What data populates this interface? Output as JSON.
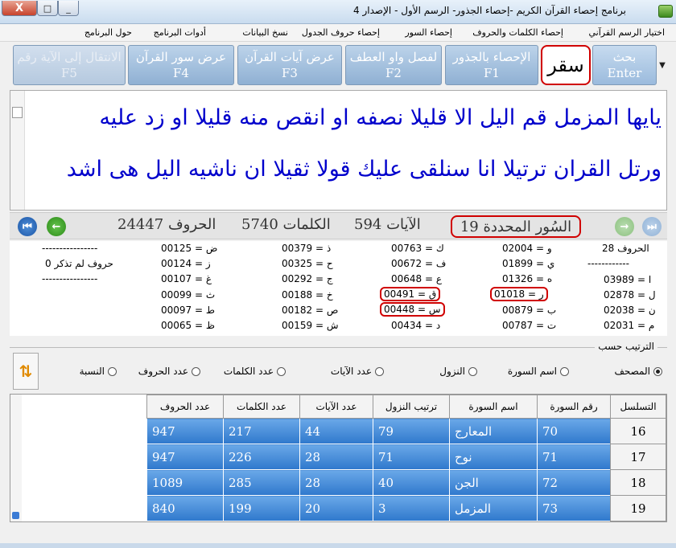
{
  "window": {
    "title": "برنامج إحصاء القرآن الكريم -إحصاء الجذور- الرسم الأول - الإصدار 4",
    "close_label": "X",
    "max_label": "□",
    "min_label": "_"
  },
  "menu": [
    "اختيار الرسم القرآني",
    "إحصاء الكلمات والحروف",
    "إحصاء السور",
    "إحصاء حروف الجدول",
    "نسخ البيانات",
    "أدوات البرنامج",
    "حول البرنامج"
  ],
  "toolbar": {
    "search": {
      "label": "بحث",
      "key": "Enter"
    },
    "search_value": "سقر",
    "buttons": [
      {
        "label": "الإحصاء بالجذور",
        "key": "F1"
      },
      {
        "label": "لفصل واو العطف",
        "key": "F2"
      },
      {
        "label": "عرض آيات القرآن",
        "key": "F3"
      },
      {
        "label": "عرض سور القرآن",
        "key": "F4"
      },
      {
        "label": "الانتقال إلى الآية رقم",
        "key": "F5"
      }
    ]
  },
  "verses": [
    "يايها المزمل قم اليل الا قليلا نصفه او انقص منه قليلا او زد عليه",
    "ورتل القران ترتيلا انا سنلقى عليك قولا ثقيلا ان ناشيه اليل هى اشد"
  ],
  "stats": {
    "surah_count": "السُور المحددة 19",
    "ayat": "الآيات 594",
    "words": "الكلمات 5740",
    "letters": "الحروف 24447"
  },
  "letter_counts": {
    "col1": {
      "header": "الحروف 28",
      "sep": "------------",
      "rows": [
        "03989 = ا",
        "02878 = ل",
        "02038 = ن",
        "02031 = م"
      ]
    },
    "col2": [
      "02004 = و",
      "01899 = ي",
      "01326 = ه",
      "01018 = ر",
      "00879 = ب",
      "00787 = ت"
    ],
    "col3": [
      "00763 = ك",
      "00672 = ف",
      "00648 = ع",
      "00491 = ق",
      "00448 = س",
      "00434 = د"
    ],
    "col4": [
      "00379 = ذ",
      "00325 = ح",
      "00292 = ج",
      "00188 = خ",
      "00182 = ص",
      "00159 = ش"
    ],
    "col5": [
      "00125 = ض",
      "00124 = ز",
      "00107 = غ",
      "00099 = ث",
      "00097 = ط",
      "00065 = ظ"
    ],
    "col6": {
      "sep1": "----------------",
      "note": "حروف لم تذكر 0",
      "sep2": "----------------"
    }
  },
  "sort": {
    "title": "الترتيب حسب",
    "options": [
      "المصحف",
      "اسم السورة",
      "النزول",
      "عدد الآيات",
      "عدد الكلمات",
      "عدد الحروف",
      "النسبة"
    ],
    "selected": "المصحف"
  },
  "table": {
    "headers": [
      "التسلسل",
      "رقم السورة",
      "اسم السورة",
      "ترتيب النزول",
      "عدد الآيات",
      "عدد الكلمات",
      "عدد الحروف"
    ],
    "rows": [
      [
        "16",
        "70",
        "المعارج",
        "79",
        "44",
        "217",
        "947"
      ],
      [
        "17",
        "71",
        "نوح",
        "71",
        "28",
        "226",
        "947"
      ],
      [
        "18",
        "72",
        "الجن",
        "40",
        "28",
        "285",
        "1089"
      ],
      [
        "19",
        "73",
        "المزمل",
        "3",
        "20",
        "199",
        "840"
      ]
    ]
  }
}
